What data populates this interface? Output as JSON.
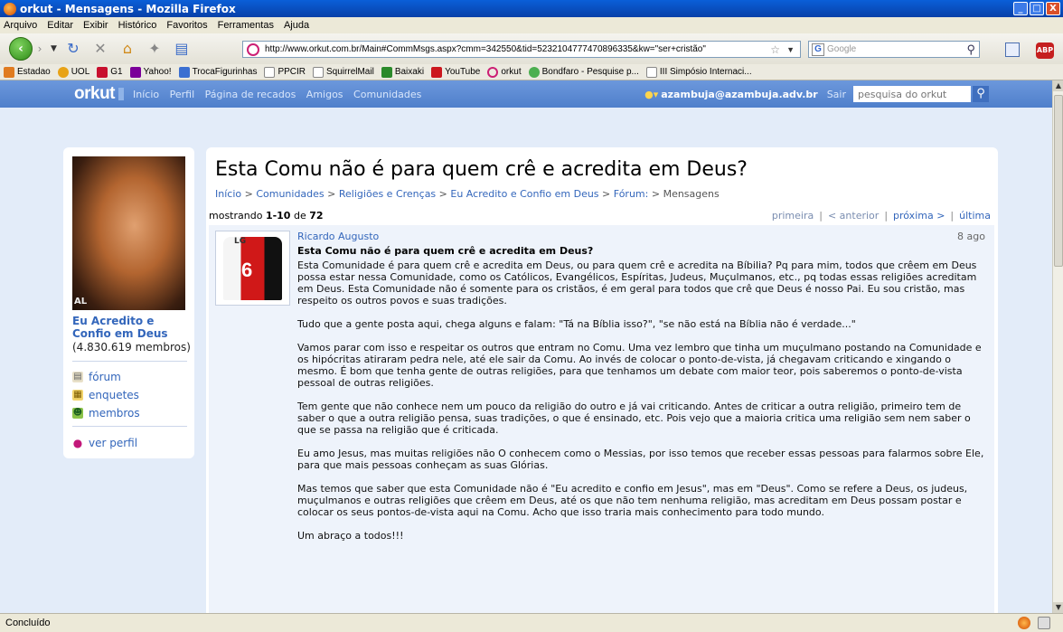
{
  "window": {
    "title": "orkut - Mensagens - Mozilla Firefox",
    "minimize": "_",
    "maximize": "□",
    "close": "X"
  },
  "menu": [
    "Arquivo",
    "Editar",
    "Exibir",
    "Histórico",
    "Favoritos",
    "Ferramentas",
    "Ajuda"
  ],
  "toolbar": {
    "url": "http://www.orkut.com.br/Main#CommMsgs.aspx?cmm=342550&tid=5232104777470896335&kw=\"ser+cristão\"",
    "search_placeholder": "Google",
    "adblock": "ABP"
  },
  "bookmarks": [
    "Estadao",
    "UOL",
    "G1",
    "Yahoo!",
    "TrocaFigurinhas",
    "PPCIR",
    "SquirrelMail",
    "Baixaki",
    "YouTube",
    "orkut",
    "Bondfaro - Pesquise p...",
    "III Simpósio Internaci..."
  ],
  "orkut_header": {
    "logo": "orkut",
    "nav": [
      "Início",
      "Perfil",
      "Página de recados",
      "Amigos",
      "Comunidades"
    ],
    "user_email": "azambuja@azambuja.adv.br",
    "logout": "Sair",
    "search_placeholder": "pesquisa do orkut"
  },
  "community": {
    "image_caption": "AL",
    "name": "Eu Acredito e Confio em Deus",
    "members": "(4.830.619 membros)",
    "links": [
      "fórum",
      "enquetes",
      "membros"
    ],
    "profile_link": "ver perfil"
  },
  "topic": {
    "title": "Esta Comu não é para quem crê e acredita em Deus?",
    "breadcrumb": [
      "Início",
      "Comunidades",
      "Religiões e Crenças",
      "Eu Acredito e Confio em Deus",
      "Fórum:"
    ],
    "breadcrumb_current": "Mensagens",
    "showing_prefix": "mostrando",
    "showing_range": "1-10",
    "showing_of": "de",
    "showing_total": "72",
    "pager": {
      "first": "primeira",
      "prev": "< anterior",
      "next": "próxima >",
      "last": "última"
    }
  },
  "message": {
    "author": "Ricardo Augusto",
    "date": "8 ago",
    "avatar_brand": "LG",
    "avatar_number": "6",
    "subject": "Esta Comu não é para quem crê e acredita em Deus?",
    "paragraphs": [
      "Esta Comunidade é para quem crê e acredita em Deus, ou para quem crê e acredita na Bíbilia? Pq para mim, todos que crêem em Deus possa estar nessa Comunidade, como os Católicos, Evangélicos, Espíritas, Judeus, Muçulmanos, etc., pq todas essas religiões acreditam em Deus. Esta Comunidade não é somente para os cristãos, é em geral para todos que crê que Deus é nosso Pai. Eu sou cristão, mas respeito os outros povos e suas tradições.",
      "Tudo que a gente posta aqui, chega alguns e falam: \"Tá na Bíblia isso?\", \"se não está na Bíblia não é verdade...\"",
      "Vamos parar com isso e respeitar os outros que entram no Comu. Uma vez lembro que tinha um muçulmano postando na Comunidade e os hipócritas atiraram pedra nele, até ele sair da Comu. Ao invés de colocar o ponto-de-vista, já chegavam criticando e xingando o mesmo. É bom que tenha gente de outras religiões, para que tenhamos um debate com maior teor, pois saberemos o ponto-de-vista pessoal de outras religiões.",
      "Tem gente que não conhece nem um pouco da religião do outro e já vai criticando. Antes de criticar a outra religião, primeiro tem de saber o que a outra religião pensa, suas tradições, o que é ensinado, etc. Pois vejo que a maioria critica uma religião sem nem saber o que se passa na religião que é criticada.",
      "Eu amo Jesus, mas muitas religiões não O conhecem como o Messias, por isso temos que receber essas pessoas para falarmos sobre Ele, para que mais pessoas conheçam as suas Glórias.",
      "Mas temos que saber que esta Comunidade não é \"Eu acredito e confio em Jesus\", mas em \"Deus\". Como se refere a Deus, os judeus, muçulmanos e outras religiões que crêem em Deus, até os que não tem nenhuma religião, mas acreditam em Deus possam postar e colocar os seus pontos-de-vista aqui na Comu. Acho que isso traria mais conhecimento para todo mundo.",
      "Um abraço a todos!!!"
    ]
  },
  "status": {
    "text": "Concluído"
  },
  "colors": {
    "orkut_blue": "#5f8fd6",
    "link": "#3366bb",
    "page_bg": "#e3ecf9",
    "message_bg": "#eef3fb"
  }
}
